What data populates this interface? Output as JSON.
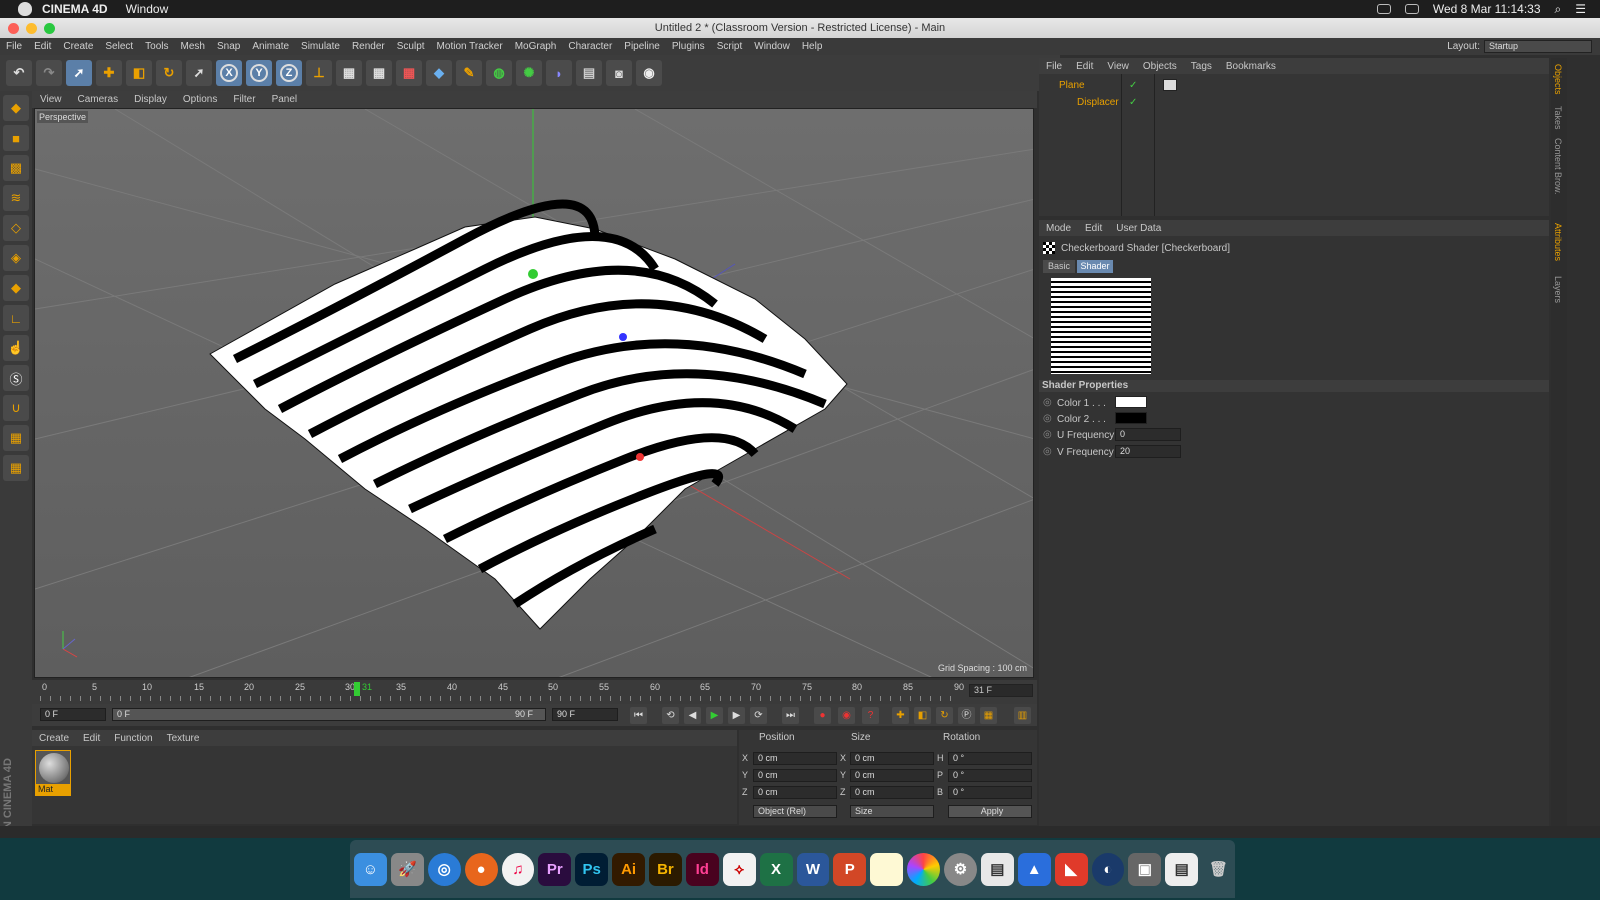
{
  "mac": {
    "app_name": "CINEMA 4D",
    "menu": "Window",
    "clock": "Wed 8 Mar  11:14:33"
  },
  "window": {
    "title": "Untitled 2 * (Classroom Version - Restricted License) - Main"
  },
  "menubar": {
    "items": [
      "File",
      "Edit",
      "Create",
      "Select",
      "Tools",
      "Mesh",
      "Snap",
      "Animate",
      "Simulate",
      "Render",
      "Sculpt",
      "Motion Tracker",
      "MoGraph",
      "Character",
      "Pipeline",
      "Plugins",
      "Script",
      "Window",
      "Help"
    ],
    "layout_label": "Layout:",
    "layout_value": "Startup"
  },
  "toolbar": {
    "axis_x": "X",
    "axis_y": "Y",
    "axis_z": "Z"
  },
  "viewport": {
    "menu": [
      "View",
      "Cameras",
      "Display",
      "Options",
      "Filter",
      "Panel"
    ],
    "label": "Perspective",
    "grid_spacing": "Grid Spacing : 100 cm"
  },
  "timeline": {
    "ticks": [
      "0",
      "5",
      "10",
      "15",
      "20",
      "25",
      "30",
      "35",
      "40",
      "45",
      "50",
      "55",
      "60",
      "65",
      "70",
      "75",
      "80",
      "85",
      "90"
    ],
    "current_marker": "31",
    "current_frame": "31 F"
  },
  "transport": {
    "start": "0 F",
    "range_start": "0 F",
    "range_end": "90 F",
    "end": "90 F"
  },
  "material": {
    "menu": [
      "Create",
      "Edit",
      "Function",
      "Texture"
    ],
    "name": "Mat",
    "brand": "MAXON CINEMA 4D"
  },
  "coords": {
    "headers": {
      "position": "Position",
      "size": "Size",
      "rotation": "Rotation"
    },
    "rows": [
      {
        "a1": "X",
        "pos": "0 cm",
        "a2": "X",
        "size": "0 cm",
        "a3": "H",
        "rot": "0 °"
      },
      {
        "a1": "Y",
        "pos": "0 cm",
        "a2": "Y",
        "size": "0 cm",
        "a3": "P",
        "rot": "0 °"
      },
      {
        "a1": "Z",
        "pos": "0 cm",
        "a2": "Z",
        "size": "0 cm",
        "a3": "B",
        "rot": "0 °"
      }
    ],
    "mode": "Object (Rel)",
    "size_mode": "Size",
    "apply": "Apply"
  },
  "objects": {
    "menu": [
      "File",
      "Edit",
      "View",
      "Objects",
      "Tags",
      "Bookmarks"
    ],
    "plane": "Plane",
    "displacer": "Displacer"
  },
  "attributes": {
    "menu": [
      "Mode",
      "Edit",
      "User Data"
    ],
    "title": "Checkerboard Shader [Checkerboard]",
    "tabs": {
      "basic": "Basic",
      "shader": "Shader"
    },
    "section": "Shader Properties",
    "props": [
      {
        "label": "Color 1 . . .",
        "type": "color",
        "value": "#ffffff"
      },
      {
        "label": "Color 2 . . .",
        "type": "color",
        "value": "#000000"
      },
      {
        "label": "U Frequency",
        "type": "num",
        "value": "0"
      },
      {
        "label": "V Frequency",
        "type": "num",
        "value": "20"
      }
    ]
  },
  "side_tabs": [
    "Objects",
    "Takes",
    "Content Brow.",
    "Attributes",
    "Layers"
  ],
  "dock": {
    "items": [
      "Finder",
      "Launchpad",
      "Safari",
      "Firefox",
      "iTunes",
      "Pr",
      "Ps",
      "Ai",
      "Br",
      "Id",
      "Acrobat",
      "X",
      "W",
      "P",
      "Notes",
      "Photos",
      "Prefs",
      "Preview",
      "Keynote",
      "Speed",
      "C4D",
      "Capture",
      "Docs",
      "Trash"
    ],
    "labels": {
      "pr": "Pr",
      "ps": "Ps",
      "ai": "Ai",
      "br": "Br",
      "id": "Id",
      "x": "X",
      "w": "W",
      "p": "P"
    }
  }
}
